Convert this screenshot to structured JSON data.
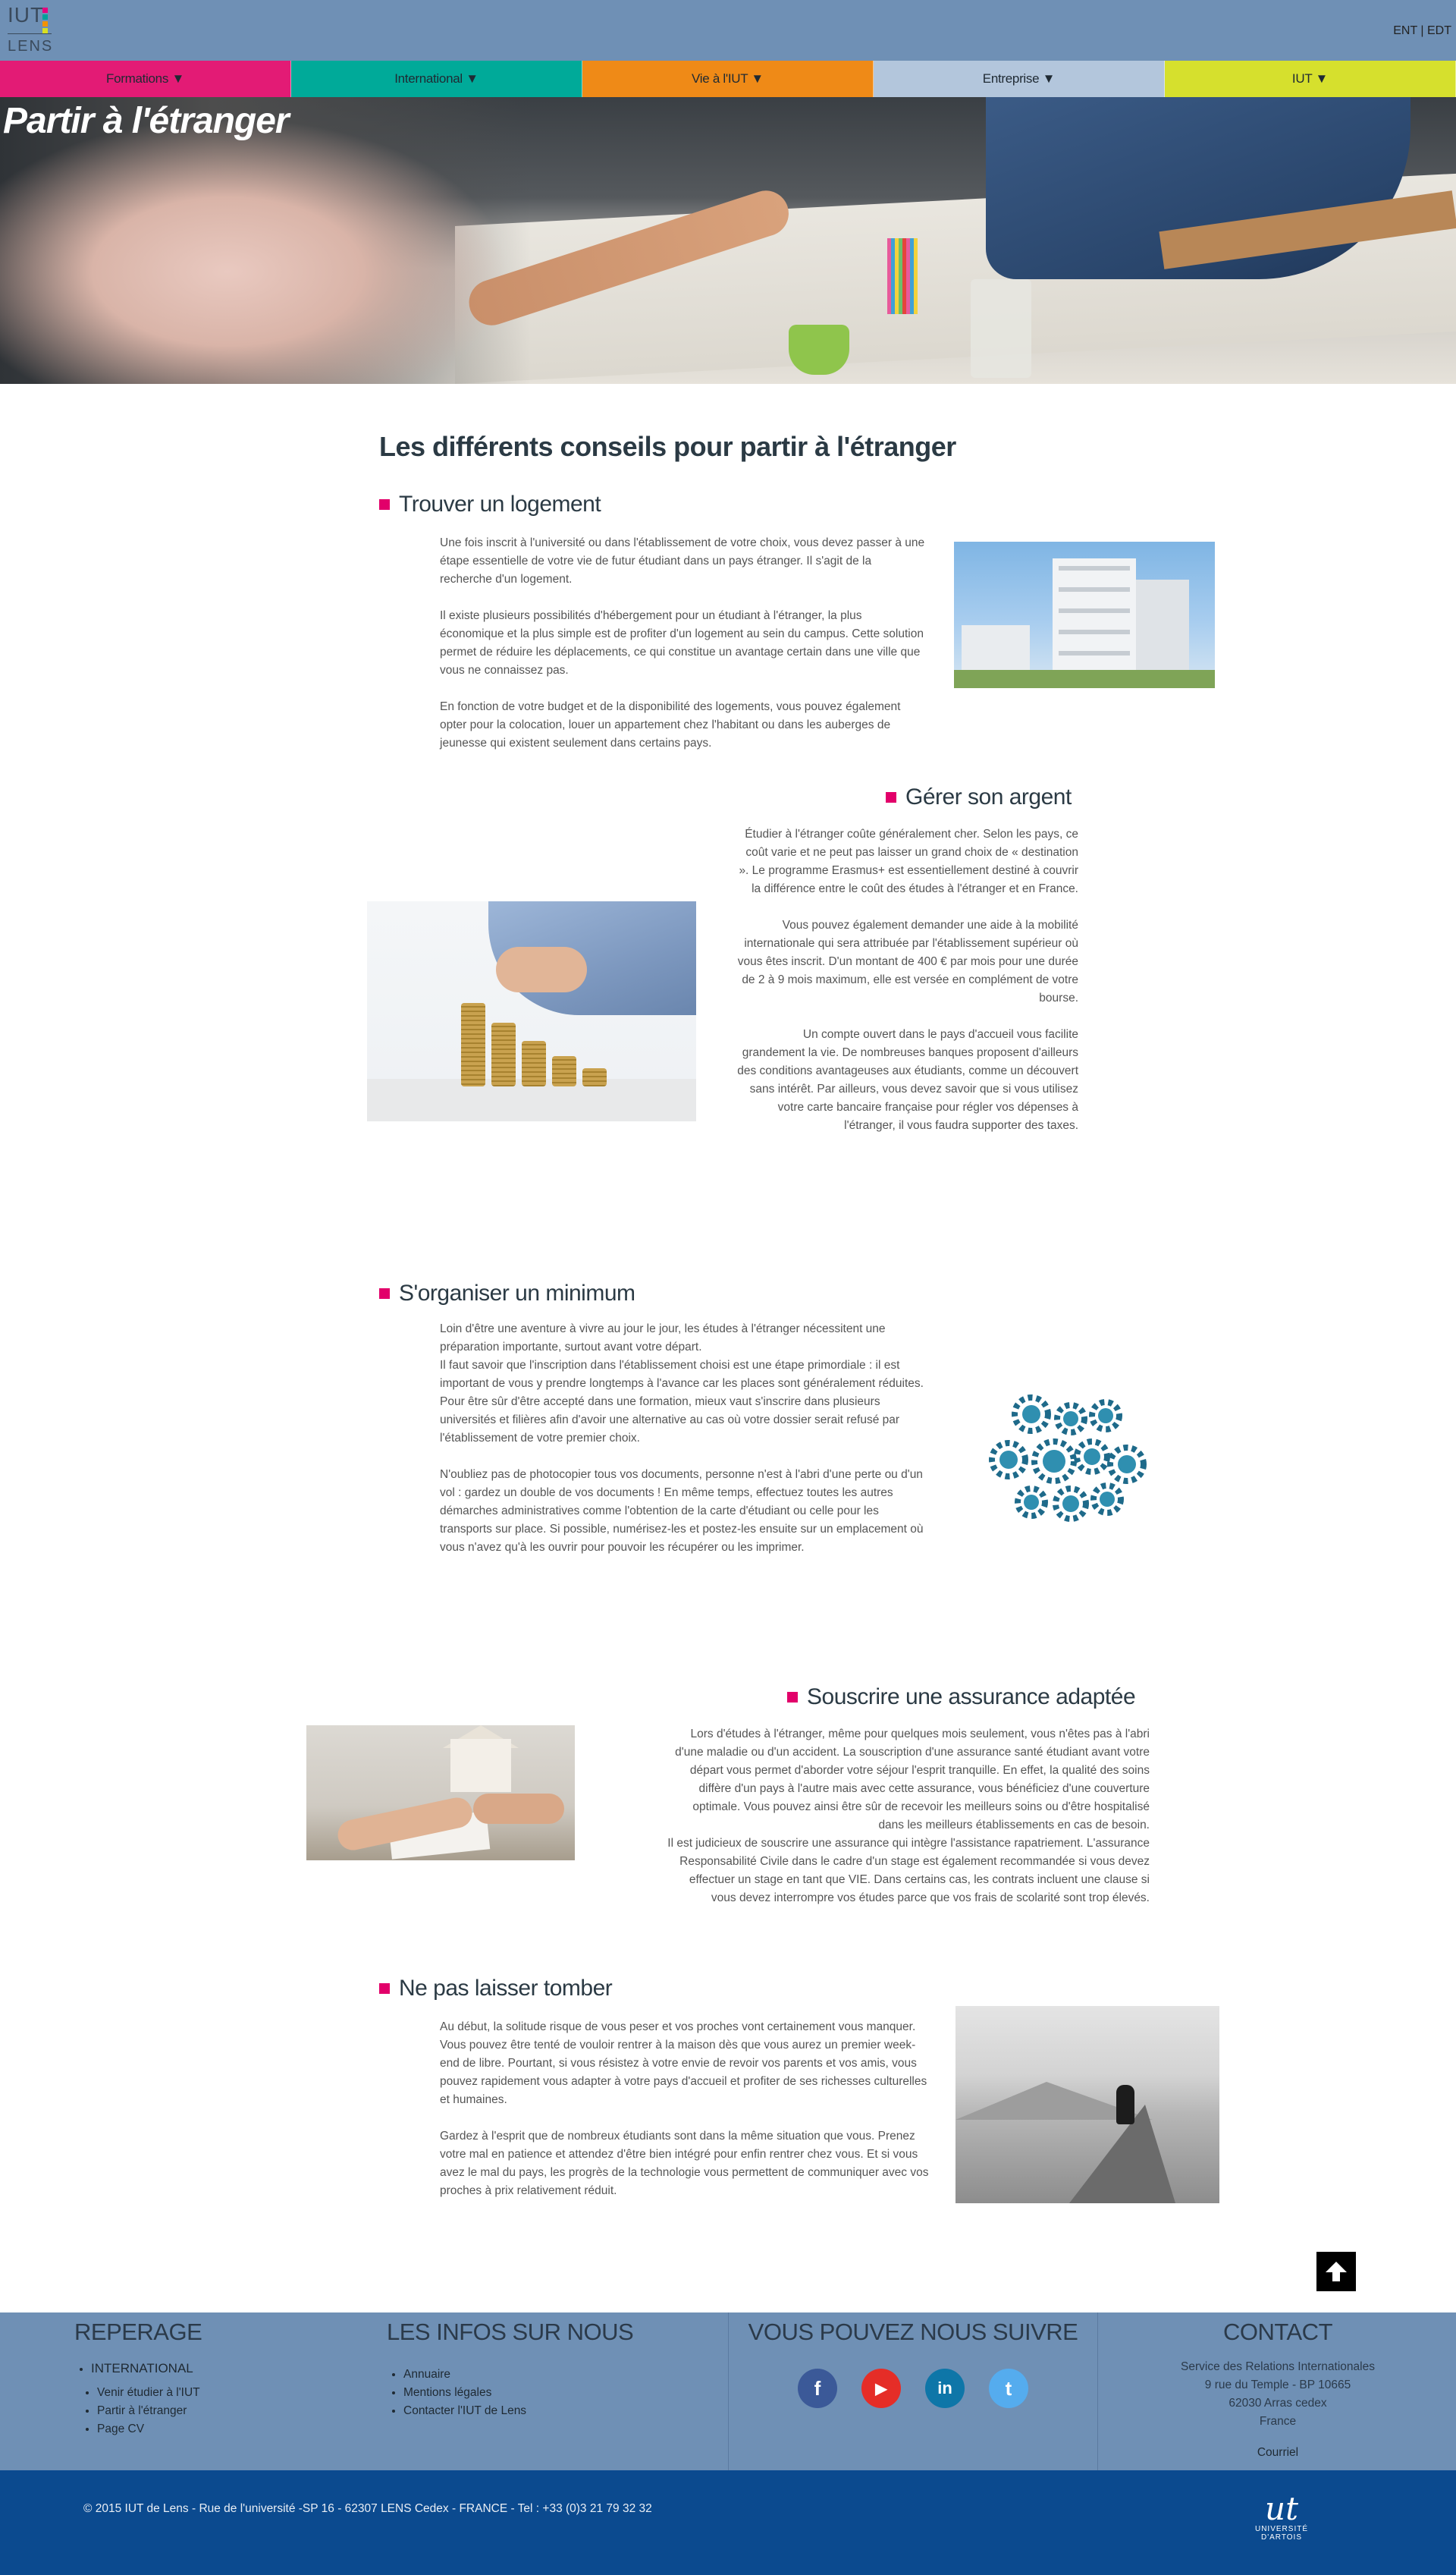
{
  "header": {
    "logo": {
      "line1": "IUT",
      "line2": "LENS",
      "dot_colors": [
        "#e5007e",
        "#00a19a",
        "#f39200",
        "#d9e021"
      ]
    },
    "top_links": [
      {
        "label": "ENT"
      },
      {
        "separator": " | "
      },
      {
        "label": "EDT"
      }
    ]
  },
  "nav": {
    "items": [
      {
        "label": "Formations ▼",
        "color": "#e31b75"
      },
      {
        "label": "International ▼",
        "color": "#00aa99"
      },
      {
        "label": "Vie à l'IUT ▼",
        "color": "#ef8a17"
      },
      {
        "label": "Entreprise ▼",
        "color": "#b3c6dc"
      },
      {
        "label": "IUT ▼",
        "color": "#d6e02d"
      }
    ]
  },
  "hero": {
    "title": "Partir à l'étranger"
  },
  "main": {
    "title": "Les différents conseils pour partir à l'étranger",
    "sections": [
      {
        "title": "Trouver un logement",
        "paragraphs": [
          "Une fois inscrit à l'université ou dans l'établissement de votre choix, vous devez passer à une étape essentielle de votre vie de futur étudiant dans un pays étranger. Il s'agit de la recherche d'un logement.",
          "Il existe plusieurs possibilités d'hébergement pour un étudiant à l'étranger, la plus économique et la plus simple est de profiter d'un logement au sein du campus. Cette solution permet de réduire les déplacements, ce qui constitue un avantage certain dans une ville que vous ne connaissez pas.",
          "En fonction de votre budget et de la disponibilité des logements, vous pouvez également opter pour la colocation, louer un appartement chez l'habitant ou dans les auberges de jeunesse qui existent seulement dans certains pays."
        ]
      },
      {
        "title": "Gérer son argent",
        "paragraphs": [
          "Étudier à l'étranger coûte généralement cher. Selon les pays, ce coût varie et ne peut pas laisser un grand choix de « destination ». Le programme Erasmus+ est essentiellement destiné à couvrir la différence entre le coût des études à l'étranger et en France.",
          "Vous pouvez également demander une aide à la mobilité internationale qui sera attribuée par l'établissement supérieur où vous êtes inscrit. D'un montant de 400 € par mois pour une durée de 2 à 9 mois maximum, elle est versée en complément de votre bourse.",
          "Un compte ouvert dans le pays d'accueil vous facilite grandement la vie. De nombreuses banques proposent d'ailleurs des conditions avantageuses aux étudiants, comme un découvert sans intérêt. Par ailleurs, vous devez savoir que si vous utilisez votre carte bancaire française pour régler vos dépenses à l'étranger, il vous faudra supporter des taxes."
        ]
      },
      {
        "title": "S'organiser un minimum",
        "paragraphs": [
          "Loin d'être une aventure à vivre au jour le jour, les études à l'étranger nécessitent une préparation importante, surtout avant votre départ.",
          "Il faut savoir que l'inscription dans l'établissement choisi est une étape primordiale : il est important de vous y prendre longtemps à l'avance car les places sont généralement réduites. Pour être sûr d'être accepté dans une formation, mieux vaut s'inscrire dans plusieurs universités et filières afin d'avoir une alternative au cas où votre dossier serait refusé par l'établissement de votre premier choix.",
          "N'oubliez pas de photocopier tous vos documents, personne n'est à l'abri d'une perte ou d'un vol : gardez un double de vos documents ! En même temps, effectuez toutes les autres démarches administratives comme l'obtention de la carte d'étudiant ou celle pour les transports sur place. Si possible, numérisez-les et postez-les ensuite sur un emplacement où vous n'avez qu'à les ouvrir pour pouvoir les récupérer ou les imprimer."
        ]
      },
      {
        "title": "Souscrire une assurance adaptée",
        "paragraphs": [
          "Lors d'études à l'étranger, même pour quelques mois seulement, vous n'êtes pas à l'abri d'une maladie ou d'un accident. La souscription d'une assurance santé étudiant avant votre départ vous permet d'aborder votre séjour l'esprit tranquille. En effet, la qualité des soins diffère d'un pays à l'autre mais avec cette assurance, vous bénéficiez d'une couverture optimale. Vous pouvez ainsi être sûr de recevoir les meilleurs soins ou d'être hospitalisé dans les meilleurs établissements en cas de besoin.",
          "Il est judicieux de souscrire une assurance qui intègre l'assistance rapatriement. L'assurance Responsabilité Civile dans le cadre d'un stage est également recommandée si vous devez effectuer un stage en tant que VIE. Dans certains cas, les contrats incluent une clause si vous devez interrompre vos études parce que vos frais de scolarité sont trop élevés."
        ]
      },
      {
        "title": "Ne pas laisser tomber",
        "paragraphs": [
          "Au  début, la solitude risque de vous peser et vos proches vont certainement vous manquer. Vous pouvez être tenté de vouloir rentrer à la maison dès que vous aurez un premier week-end de libre. Pourtant, si vous résistez à votre envie de revoir vos parents et vos amis, vous pouvez rapidement vous adapter à votre pays d'accueil et profiter de ses richesses culturelles et humaines.",
          "Gardez à l'esprit que de nombreux étudiants sont dans la même situation que vous. Prenez votre mal en patience et attendez d'être bien intégré pour enfin rentrer chez vous. Et si vous avez le mal du pays, les progrès de la technologie vous permettent de communiquer avec vos proches à prix relativement réduit."
        ]
      }
    ]
  },
  "footer": {
    "reperage": {
      "title": "REPERAGE",
      "parent": "INTERNATIONAL",
      "links": [
        "Venir étudier à l'IUT",
        "Partir à l'étranger",
        "Page CV"
      ]
    },
    "infos": {
      "title": "LES INFOS SUR NOUS",
      "links": [
        "Annuaire",
        "Mentions légales",
        "Contacter l'IUT de Lens"
      ]
    },
    "follow": {
      "title": "VOUS POUVEZ NOUS SUIVRE",
      "socials": [
        {
          "icon": "facebook-icon",
          "glyph": "f",
          "color": "#3b5998"
        },
        {
          "icon": "youtube-icon",
          "glyph": "▶",
          "color": "#e52d27"
        },
        {
          "icon": "linkedin-icon",
          "glyph": "in",
          "color": "#0e76a8"
        },
        {
          "icon": "twitter-icon",
          "glyph": "t",
          "color": "#55acee"
        }
      ]
    },
    "contact": {
      "title": "CONTACT",
      "address": [
        "Service des Relations Internationales",
        "9 rue du Temple - BP 10665",
        "62030 Arras cedex",
        "France"
      ],
      "email_label": "Courriel"
    },
    "copyright": "© 2015 IUT de Lens - Rue de l'université -SP 16 - 62307 LENS Cedex - FRANCE - Tel : +33 (0)3 21 79 32 32",
    "univ_logo": {
      "mark": "ut",
      "name": "UNIVERSITÉ D'ARTOIS"
    }
  }
}
